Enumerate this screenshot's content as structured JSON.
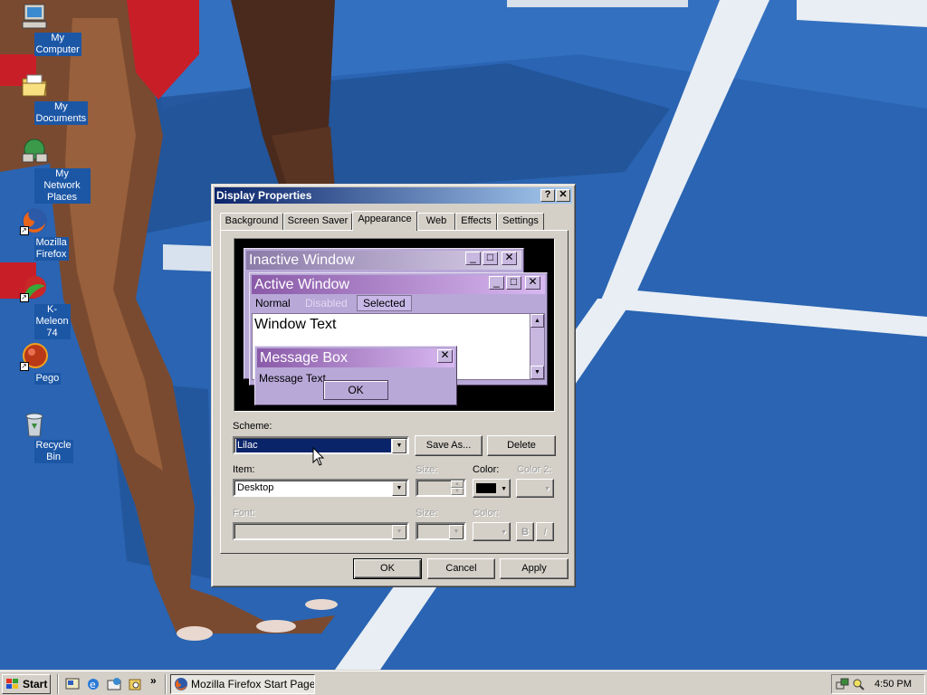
{
  "desktop": {
    "icons": [
      {
        "label": "My Computer",
        "icon": "computer-icon"
      },
      {
        "label": "My Documents",
        "icon": "folder-icon"
      },
      {
        "label": "My Network Places",
        "icon": "network-icon"
      },
      {
        "label": "Mozilla Firefox",
        "icon": "firefox-icon"
      },
      {
        "label": "K-Meleon 74",
        "icon": "kmeleon-icon"
      },
      {
        "label": "Pego",
        "icon": "pego-icon"
      },
      {
        "label": "Recycle Bin",
        "icon": "recycle-bin-icon"
      }
    ]
  },
  "dialog": {
    "title": "Display Properties",
    "help_label": "?",
    "close_label": "✕",
    "tabs": [
      {
        "label": "Background"
      },
      {
        "label": "Screen Saver"
      },
      {
        "label": "Appearance"
      },
      {
        "label": "Web"
      },
      {
        "label": "Effects"
      },
      {
        "label": "Settings"
      }
    ],
    "active_tab": "Appearance",
    "preview": {
      "inactive_title": "Inactive Window",
      "active_title": "Active Window",
      "menu": [
        "Normal",
        "Disabled",
        "Selected"
      ],
      "window_text": "Window Text",
      "message_box_title": "Message Box",
      "message_text": "Message Text",
      "ok_label": "OK",
      "colors": {
        "inactive_title_start": "#8a7aa8",
        "inactive_title_end": "#d8d0e8",
        "active_title_start": "#8a5aa8",
        "active_title_end": "#d8b8f0",
        "face": "#b8a8d8",
        "selected": "#c8b8e8"
      }
    },
    "scheme_label": "Scheme:",
    "scheme_value": "Lilac",
    "save_as_label": "Save As...",
    "delete_label": "Delete",
    "item_label": "Item:",
    "item_value": "Desktop",
    "size_label": "Size:",
    "color_label": "Color:",
    "color2_label": "Color 2:",
    "font_label": "Font:",
    "font_size_label": "Size:",
    "font_color_label": "Color:",
    "bold_label": "B",
    "italic_label": "I",
    "ok_label": "OK",
    "cancel_label": "Cancel",
    "apply_label": "Apply"
  },
  "taskbar": {
    "start_label": "Start",
    "chevron": "»",
    "task_label": "Mozilla Firefox Start Page -...",
    "clock": "4:50 PM"
  }
}
